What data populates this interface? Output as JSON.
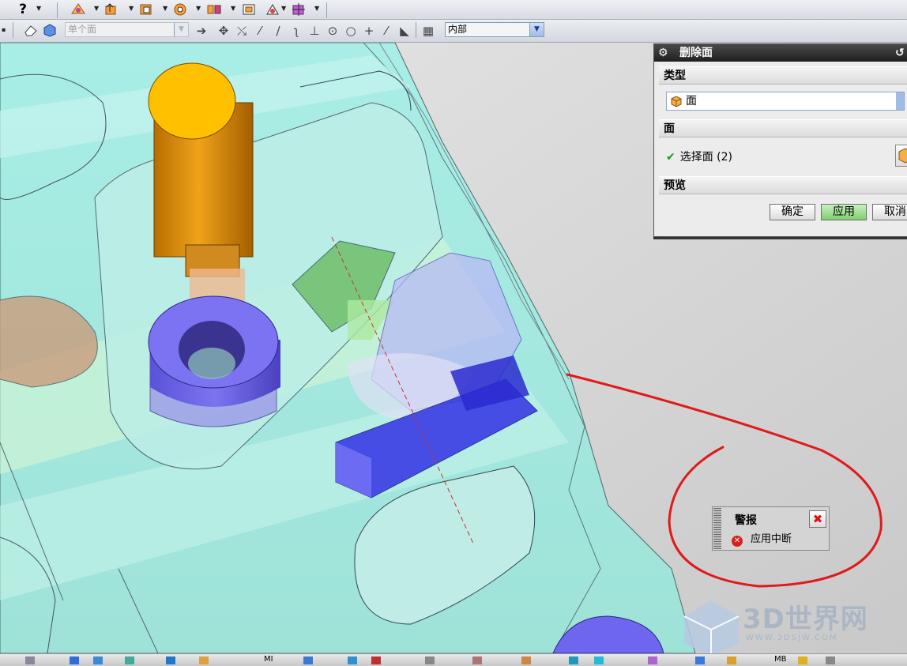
{
  "toolbar_top": {
    "help_label": "?",
    "icons": [
      "sketch-icon",
      "extrude-icon",
      "feature-icon",
      "hole-icon",
      "mirror-icon",
      "assembly-icon",
      "cube-icon",
      "move-icon"
    ]
  },
  "toolbar_select": {
    "filter_value": "单个面",
    "scope_value": "内部",
    "snap_icons": [
      "point-icon",
      "line-icon",
      "arc-icon",
      "intersect-icon",
      "center-icon",
      "tangent-icon",
      "midpoint-icon",
      "pole-icon"
    ]
  },
  "dialog": {
    "title": "删除面",
    "section_type": "类型",
    "type_value": "面",
    "section_face": "面",
    "select_face_label": "选择面 (2)",
    "section_preview": "预览",
    "ok_label": "确定",
    "apply_label": "应用",
    "cancel_label": "取消"
  },
  "alert": {
    "title": "警报",
    "message": "应用中断"
  },
  "watermark": {
    "brand": "3D世界网",
    "url": "WWW.3DSJW.COM"
  },
  "taskbar": {
    "labels": [
      "MI",
      "MB"
    ]
  }
}
